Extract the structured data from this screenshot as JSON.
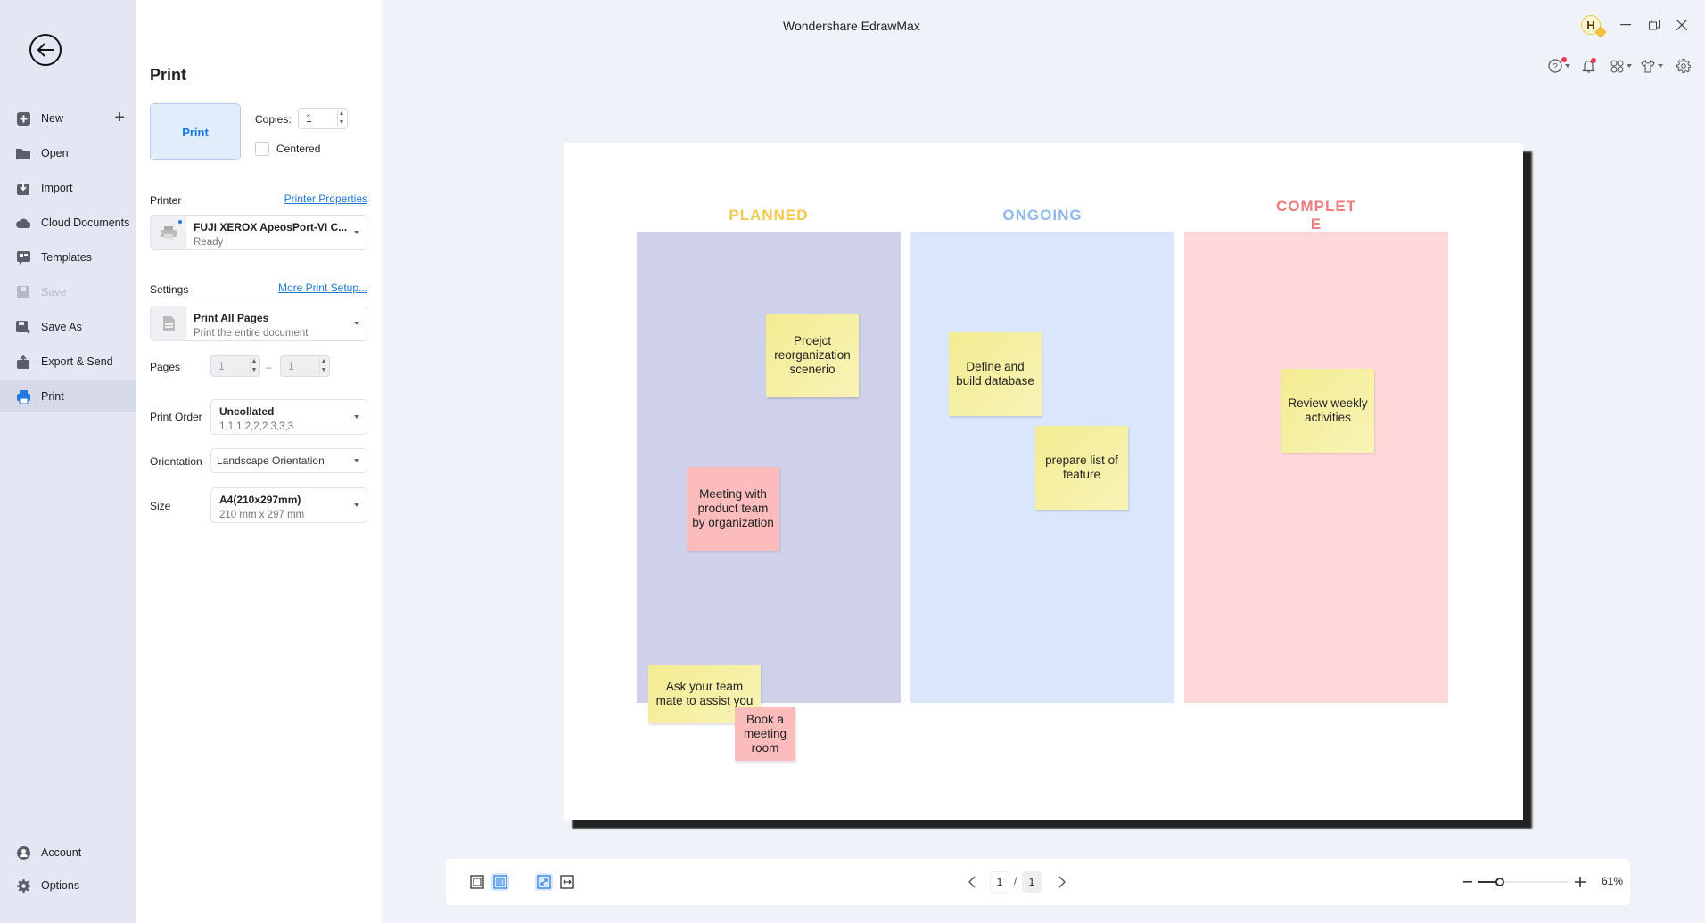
{
  "app": {
    "title": "Wondershare EdrawMax",
    "avatar_initial": "H"
  },
  "nav": {
    "items": [
      {
        "label": "New",
        "icon": "new-file-icon"
      },
      {
        "label": "Open",
        "icon": "folder-icon"
      },
      {
        "label": "Import",
        "icon": "import-icon"
      },
      {
        "label": "Cloud Documents",
        "icon": "cloud-icon"
      },
      {
        "label": "Templates",
        "icon": "templates-icon"
      },
      {
        "label": "Save",
        "icon": "save-icon",
        "disabled": true
      },
      {
        "label": "Save As",
        "icon": "save-as-icon"
      },
      {
        "label": "Export & Send",
        "icon": "export-icon"
      },
      {
        "label": "Print",
        "icon": "printer-icon",
        "active": true
      }
    ],
    "bottom_items": [
      {
        "label": "Account",
        "icon": "account-icon"
      },
      {
        "label": "Options",
        "icon": "gear-icon"
      }
    ]
  },
  "print_panel": {
    "title": "Print",
    "print_button": "Print",
    "copies_label": "Copies:",
    "copies_value": "1",
    "centered_label": "Centered",
    "centered_checked": false,
    "printer_label": "Printer",
    "printer_properties_link": "Printer Properties",
    "printer_name": "FUJI XEROX ApeosPort-VI C...",
    "printer_status": "Ready",
    "settings_label": "Settings",
    "more_setup_link": "More Print Setup...",
    "settings_title": "Print All Pages",
    "settings_subtitle": "Print the entire document",
    "pages_label": "Pages",
    "pages_from": "1",
    "pages_dash": "–",
    "pages_to": "1",
    "print_order_label": "Print Order",
    "print_order_title": "Uncollated",
    "print_order_subtitle": "1,1,1  2,2,2  3,3,3",
    "orientation_label": "Orientation",
    "orientation_value": "Landscape Orientation",
    "size_label": "Size",
    "size_title": "A4(210x297mm)",
    "size_subtitle": "210 mm x 297 mm"
  },
  "diagram": {
    "lanes": [
      {
        "title": "PLANNED",
        "title_color": "#f2c94c",
        "fill": "#cfd1ea"
      },
      {
        "title": "ONGOING",
        "title_color": "#8fb7ef",
        "fill": "#dae6fb"
      },
      {
        "title": "COMPLET\nE",
        "title_color": "#ef7b7b",
        "fill": "#fed8d8"
      }
    ],
    "notes": [
      {
        "text": "Proejct reorganization scenerio",
        "color": "yellow",
        "lane": "PLANNED"
      },
      {
        "text": "Meeting with product team by organization",
        "color": "pink",
        "lane": "PLANNED"
      },
      {
        "text": "Ask your team mate to assist you",
        "color": "yellow",
        "lane": "PLANNED"
      },
      {
        "text": "Book a meeting room",
        "color": "pink",
        "lane": "PLANNED"
      },
      {
        "text": "Define and build database",
        "color": "yellow",
        "lane": "ONGOING"
      },
      {
        "text": "prepare list of feature",
        "color": "yellow",
        "lane": "ONGOING"
      },
      {
        "text": "Review weekly activities",
        "color": "yellow",
        "lane": "COMPLETE"
      }
    ]
  },
  "bottom_bar": {
    "page_current": "1",
    "page_separator": "/",
    "page_total": "1",
    "zoom_percent_label": "61%",
    "zoom_slider_fraction": 0.24
  }
}
